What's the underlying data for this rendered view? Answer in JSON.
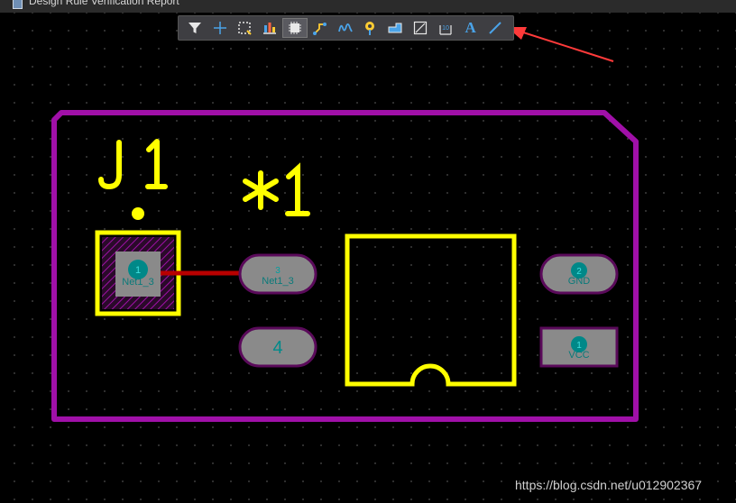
{
  "window": {
    "title": "Design Rule Verification Report"
  },
  "toolbar": {
    "buttons": [
      {
        "icon": "filter-icon"
      },
      {
        "icon": "crosshair-icon"
      },
      {
        "icon": "select-rect-icon"
      },
      {
        "icon": "align-icon"
      },
      {
        "icon": "component-icon",
        "active": true
      },
      {
        "icon": "route-icon"
      },
      {
        "icon": "interactive-route-icon"
      },
      {
        "icon": "pad-via-icon"
      },
      {
        "icon": "polygon-icon"
      },
      {
        "icon": "region-icon"
      },
      {
        "icon": "dimension-icon"
      },
      {
        "icon": "text-icon",
        "label": "A"
      },
      {
        "icon": "line-icon"
      }
    ]
  },
  "pcb": {
    "designator": "J1",
    "comment": "✱1",
    "pads": [
      {
        "number": "1",
        "net": "Net1_3"
      },
      {
        "number": "3",
        "net": "Net1_3"
      },
      {
        "number": "4",
        "net": ""
      },
      {
        "number": "2",
        "net": "GND"
      },
      {
        "number": "1",
        "net": "VCC"
      }
    ]
  },
  "colors": {
    "board_outline": "#a010a8",
    "silkscreen": "#ffff00",
    "pad_fill": "#8a8a8a",
    "pad_ring": "#6a0a6a",
    "track": "#b80000",
    "pad_number": "#00a8a8",
    "arrow": "#ff3a3a"
  },
  "watermark": "https://blog.csdn.net/u012902367"
}
